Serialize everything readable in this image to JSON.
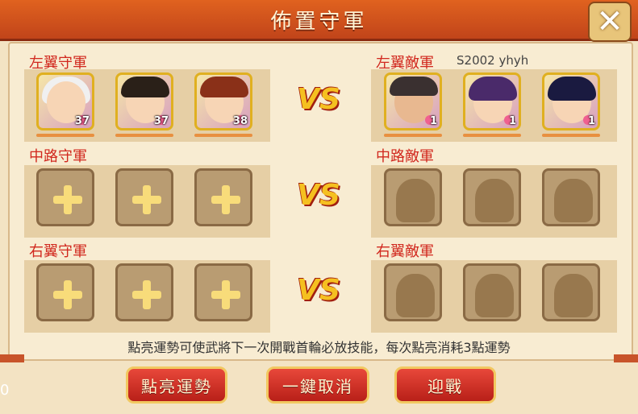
{
  "window": {
    "title": "佈置守軍",
    "close_label": "✕"
  },
  "lanes": {
    "left_defense_label": "左翼守軍",
    "left_enemy_label": "左翼敵軍",
    "mid_defense_label": "中路守軍",
    "mid_enemy_label": "中路敵軍",
    "right_defense_label": "右翼守軍",
    "right_enemy_label": "右翼敵軍",
    "enemy_player_name": "S2002 yhyh"
  },
  "heroes_left": [
    {
      "level": "37",
      "hair": "#f0f0f0"
    },
    {
      "level": "37",
      "hair": "#2a2018"
    },
    {
      "level": "38",
      "hair": "#8a3018"
    }
  ],
  "enemies_left": [
    {
      "level": "1",
      "hair": "#3a3030"
    },
    {
      "level": "1",
      "hair": "#4a2a6a"
    },
    {
      "level": "1",
      "hair": "#1a1a40"
    }
  ],
  "vs_label": "VS",
  "tip": "點亮運勢可使武將下一次開戰首輪必放技能，每次點亮消耗3點運勢",
  "buttons": {
    "light_fortune": "點亮運勢",
    "cancel_all": "一鍵取消",
    "fight": "迎戰"
  },
  "side_number": "0",
  "colors": {
    "accent": "#d1281e",
    "title_bar": "#d4541e",
    "panel": "#f3e3c3"
  }
}
